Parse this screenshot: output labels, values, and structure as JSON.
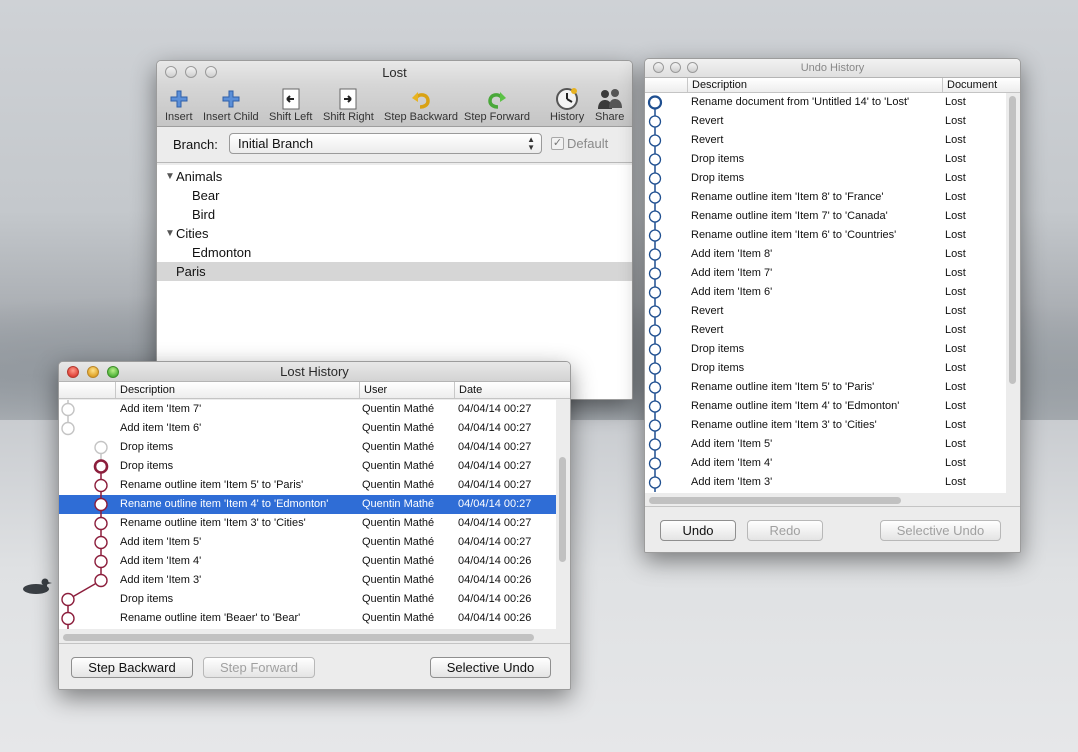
{
  "lost_window": {
    "title": "Lost",
    "toolbar": [
      {
        "label": "Insert",
        "icon": "plus-icon"
      },
      {
        "label": "Insert Child",
        "icon": "plus-child-icon"
      },
      {
        "label": "Shift Left",
        "icon": "shift-left-icon"
      },
      {
        "label": "Shift Right",
        "icon": "shift-right-icon"
      },
      {
        "label": "Step Backward",
        "icon": "undo-arrow-icon"
      },
      {
        "label": "Step Forward",
        "icon": "redo-arrow-icon"
      },
      {
        "label": "History",
        "icon": "clock-icon"
      },
      {
        "label": "Share",
        "icon": "people-icon"
      }
    ],
    "branch_label": "Branch:",
    "branch_value": "Initial Branch",
    "default_label": "Default",
    "outline": [
      {
        "label": "Animals",
        "expanded": true,
        "level": 0
      },
      {
        "label": "Bear",
        "level": 1
      },
      {
        "label": "Bird",
        "level": 1
      },
      {
        "label": "Cities",
        "expanded": true,
        "level": 0
      },
      {
        "label": "Edmonton",
        "level": 1
      },
      {
        "label": "Paris",
        "level": 0,
        "selected": true
      }
    ]
  },
  "undo_window": {
    "title": "Undo History",
    "columns": [
      "Description",
      "Document"
    ],
    "rows": [
      {
        "description": "Rename document from 'Untitled 14' to 'Lost'",
        "document": "Lost",
        "current": true
      },
      {
        "description": "Revert",
        "document": "Lost"
      },
      {
        "description": "Revert",
        "document": "Lost"
      },
      {
        "description": "Drop items",
        "document": "Lost"
      },
      {
        "description": "Drop items",
        "document": "Lost"
      },
      {
        "description": "Rename outline item 'Item 8' to 'France'",
        "document": "Lost"
      },
      {
        "description": "Rename outline item 'Item 7' to 'Canada'",
        "document": "Lost"
      },
      {
        "description": "Rename outline item 'Item 6' to 'Countries'",
        "document": "Lost"
      },
      {
        "description": "Add item 'Item 8'",
        "document": "Lost"
      },
      {
        "description": "Add item 'Item 7'",
        "document": "Lost"
      },
      {
        "description": "Add item 'Item 6'",
        "document": "Lost"
      },
      {
        "description": "Revert",
        "document": "Lost"
      },
      {
        "description": "Revert",
        "document": "Lost"
      },
      {
        "description": "Drop items",
        "document": "Lost"
      },
      {
        "description": "Drop items",
        "document": "Lost"
      },
      {
        "description": "Rename outline item 'Item 5' to 'Paris'",
        "document": "Lost"
      },
      {
        "description": "Rename outline item 'Item 4' to 'Edmonton'",
        "document": "Lost"
      },
      {
        "description": "Rename outline item 'Item 3' to 'Cities'",
        "document": "Lost"
      },
      {
        "description": "Add item 'Item 5'",
        "document": "Lost"
      },
      {
        "description": "Add item 'Item 4'",
        "document": "Lost"
      },
      {
        "description": "Add item 'Item 3'",
        "document": "Lost"
      }
    ],
    "buttons": {
      "undo": "Undo",
      "redo": "Redo",
      "selective_undo": "Selective Undo"
    }
  },
  "history_window": {
    "title": "Lost History",
    "columns": [
      "Description",
      "User",
      "Date"
    ],
    "rows": [
      {
        "description": "Add item 'Item 7'",
        "user": "Quentin Mathé",
        "date": "04/04/14 00:27"
      },
      {
        "description": "Add item 'Item 6'",
        "user": "Quentin Mathé",
        "date": "04/04/14 00:27"
      },
      {
        "description": "Drop items",
        "user": "Quentin Mathé",
        "date": "04/04/14 00:27"
      },
      {
        "description": "Drop items",
        "user": "Quentin Mathé",
        "date": "04/04/14 00:27"
      },
      {
        "description": "Rename outline item 'Item 5' to 'Paris'",
        "user": "Quentin Mathé",
        "date": "04/04/14 00:27"
      },
      {
        "description": "Rename outline item 'Item 4' to 'Edmonton'",
        "user": "Quentin Mathé",
        "date": "04/04/14 00:27",
        "selected": true
      },
      {
        "description": "Rename outline item 'Item 3' to 'Cities'",
        "user": "Quentin Mathé",
        "date": "04/04/14 00:27"
      },
      {
        "description": "Add item 'Item 5'",
        "user": "Quentin Mathé",
        "date": "04/04/14 00:27"
      },
      {
        "description": "Add item 'Item 4'",
        "user": "Quentin Mathé",
        "date": "04/04/14 00:26"
      },
      {
        "description": "Add item 'Item 3'",
        "user": "Quentin Mathé",
        "date": "04/04/14 00:26"
      },
      {
        "description": "Drop items",
        "user": "Quentin Mathé",
        "date": "04/04/14 00:26"
      },
      {
        "description": "Rename outline item 'Beaer' to 'Bear'",
        "user": "Quentin Mathé",
        "date": "04/04/14 00:26"
      }
    ],
    "buttons": {
      "step_backward": "Step Backward",
      "step_forward": "Step Forward",
      "selective_undo": "Selective Undo"
    }
  },
  "colors": {
    "selection": "#2f6dd6",
    "graph_red": "#8c1e3c",
    "graph_blue": "#1f4f90"
  }
}
